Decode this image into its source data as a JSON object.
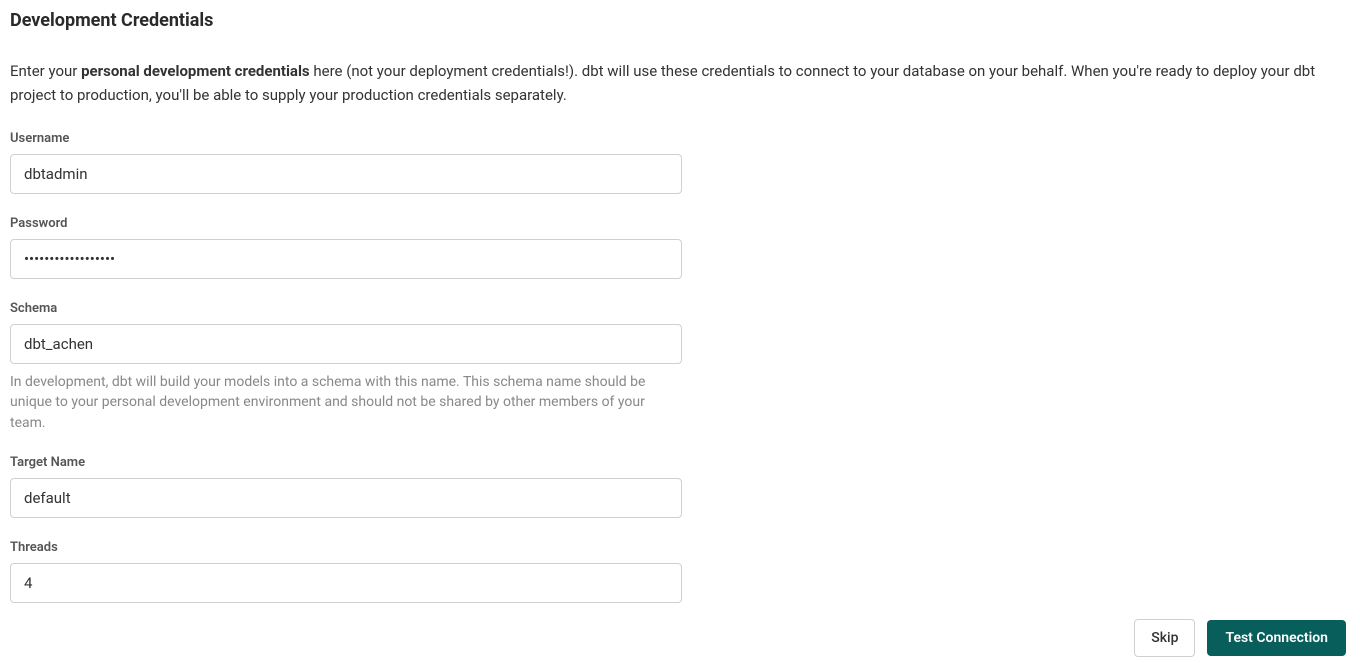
{
  "title": "Development Credentials",
  "description": {
    "prefix": "Enter your ",
    "bold": "personal development credentials",
    "suffix": " here (not your deployment credentials!). dbt will use these credentials to connect to your database on your behalf. When you're ready to deploy your dbt project to production, you'll be able to supply your production credentials separately."
  },
  "fields": {
    "username": {
      "label": "Username",
      "value": "dbtadmin"
    },
    "password": {
      "label": "Password",
      "value": "••••••••••••••••••"
    },
    "schema": {
      "label": "Schema",
      "value": "dbt_achen",
      "help": "In development, dbt will build your models into a schema with this name. This schema name should be unique to your personal development environment and should not be shared by other members of your team."
    },
    "target_name": {
      "label": "Target Name",
      "value": "default"
    },
    "threads": {
      "label": "Threads",
      "value": "4"
    }
  },
  "buttons": {
    "skip": "Skip",
    "test_connection": "Test Connection"
  }
}
